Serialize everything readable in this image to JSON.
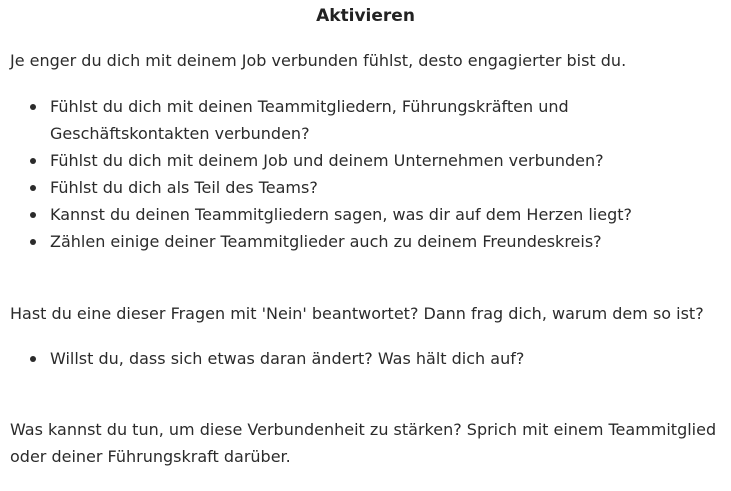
{
  "title": "Aktivieren",
  "intro": "Je enger du dich mit deinem Job verbunden fühlst, desto engagierter bist du.",
  "questions": [
    "Fühlst du dich mit deinen Teammitgliedern, Führungskräften und Geschäftskontakten verbunden?",
    "Fühlst du dich mit deinem Job und deinem Unternehmen verbunden?",
    "Fühlst du dich als Teil des Teams?",
    "Kannst du deinen Teammitgliedern sagen, was dir auf dem Herzen liegt?",
    "Zählen einige deiner Teammitglieder auch zu deinem Freundeskreis?"
  ],
  "followup": "Hast du eine dieser Fragen mit 'Nein' beantwortet? Dann frag dich, warum dem so ist?",
  "followup_items": [
    "Willst du, dass sich etwas daran ändert? Was hält dich auf?"
  ],
  "closing": "Was kannst du tun, um diese Verbundenheit zu stärken? Sprich mit einem Teammitglied oder deiner Führungskraft darüber."
}
